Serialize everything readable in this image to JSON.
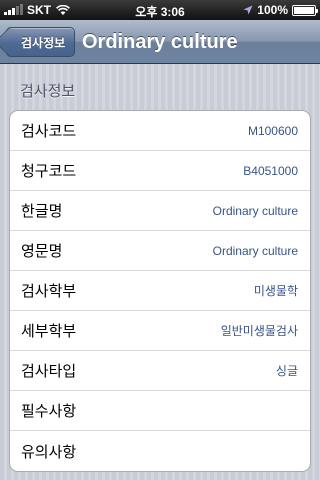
{
  "status_bar": {
    "carrier": "SKT",
    "time": "오후 3:06",
    "battery": "100%",
    "battery_level": 1.0,
    "icons": [
      "signal-bars-icon",
      "wifi-icon",
      "location-arrow-icon",
      "battery-icon"
    ]
  },
  "nav": {
    "back_label": "검사정보",
    "title": "Ordinary culture"
  },
  "section": {
    "header": "검사정보",
    "rows": [
      {
        "label": "검사코드",
        "value": "M100600"
      },
      {
        "label": "청구코드",
        "value": "B4051000"
      },
      {
        "label": "한글명",
        "value": "Ordinary culture"
      },
      {
        "label": "영문명",
        "value": "Ordinary culture"
      },
      {
        "label": "검사학부",
        "value": "미생물학"
      },
      {
        "label": "세부학부",
        "value": "일반미생물검사"
      },
      {
        "label": "검사타입",
        "value": "싱글"
      },
      {
        "label": "필수사항",
        "value": ""
      },
      {
        "label": "유의사항",
        "value": ""
      }
    ]
  },
  "colors": {
    "nav_bar": "#6d84a1",
    "value_text": "#385487",
    "section_header": "#4c566c"
  }
}
